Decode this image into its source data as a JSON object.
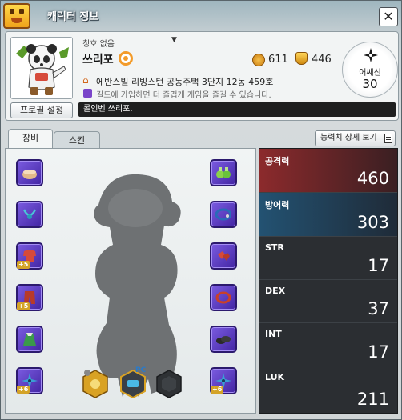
{
  "window": {
    "title": "캐릭터 정보",
    "close_glyph": "✕"
  },
  "profile": {
    "title_label": "칭호 없음",
    "title_dropdown_glyph": "▼",
    "name": "쓰리포",
    "stat_a": "611",
    "stat_b": "446",
    "home": "에반스빌 리빙스턴 공동주택 3단지 12동 459호",
    "guild": "길드에 가입하면 더 즐겁게 게임을 즐길 수 있습니다.",
    "message": "롤인벤 쓰리포.",
    "profile_button": "프로필 설정",
    "medal_label": "어쌔신",
    "medal_value": "30"
  },
  "tabs": [
    {
      "label": "장비",
      "active": true
    },
    {
      "label": "스킨",
      "active": false
    }
  ],
  "stat_detail_button": "능력치 상세 보기",
  "equipment": {
    "left_slots": [
      {
        "name": "bowl-item",
        "enhance": ""
      },
      {
        "name": "necklace-item",
        "enhance": ""
      },
      {
        "name": "top-armor-item",
        "enhance": "+5"
      },
      {
        "name": "pants-item",
        "enhance": "+5"
      },
      {
        "name": "cape-item",
        "enhance": ""
      },
      {
        "name": "shuriken-item",
        "enhance": "+6"
      }
    ],
    "right_slots": [
      {
        "name": "potion-item",
        "enhance": ""
      },
      {
        "name": "collar-item",
        "enhance": ""
      },
      {
        "name": "gloves-item",
        "enhance": ""
      },
      {
        "name": "ring-item",
        "enhance": ""
      },
      {
        "name": "shoes-item",
        "enhance": ""
      },
      {
        "name": "shuriken-item",
        "enhance": "+6"
      }
    ],
    "pc_label": "PC"
  },
  "stats": [
    {
      "key": "atk",
      "label": "공격력",
      "value": "460"
    },
    {
      "key": "def",
      "label": "방어력",
      "value": "303"
    },
    {
      "key": "str",
      "label": "STR",
      "value": "17"
    },
    {
      "key": "dex",
      "label": "DEX",
      "value": "37"
    },
    {
      "key": "int",
      "label": "INT",
      "value": "17"
    },
    {
      "key": "luk",
      "label": "LUK",
      "value": "211"
    }
  ],
  "colors": {
    "atk_row": "#8c2a2c",
    "def_row": "#235272",
    "slot_purple": "#5a3ccc",
    "badge_orange": "#f39b2a"
  }
}
